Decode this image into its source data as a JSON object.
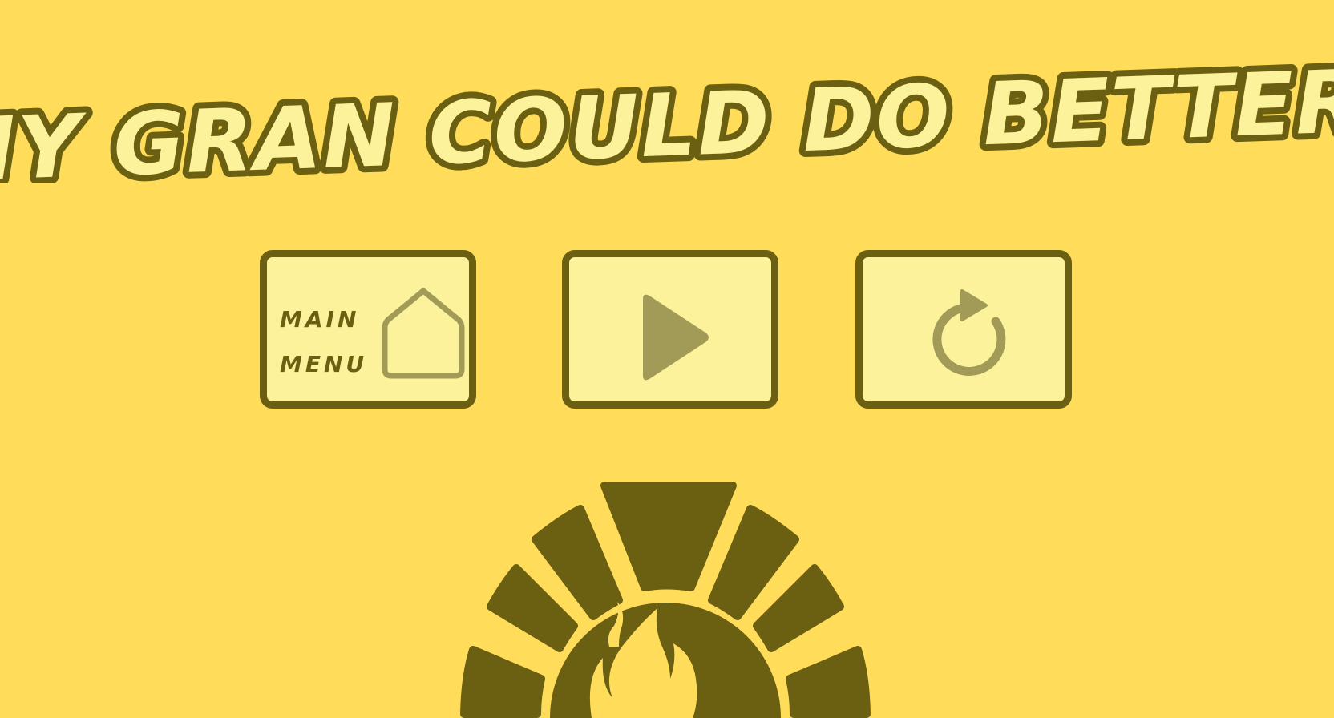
{
  "game": {
    "title": "MY GRAN COULD DO BETTER!"
  },
  "menu": {
    "main_menu_label": "MAIN MENU",
    "main_menu_icon": "home-icon",
    "play_icon": "play-icon",
    "restart_icon": "restart-icon"
  },
  "decoration": {
    "oven_icon": "pizza-oven-icon"
  },
  "colors": {
    "background": "#FFDD5A",
    "panel": "#FCF29B",
    "outline": "#6B6012",
    "icon": "#A29A57"
  }
}
